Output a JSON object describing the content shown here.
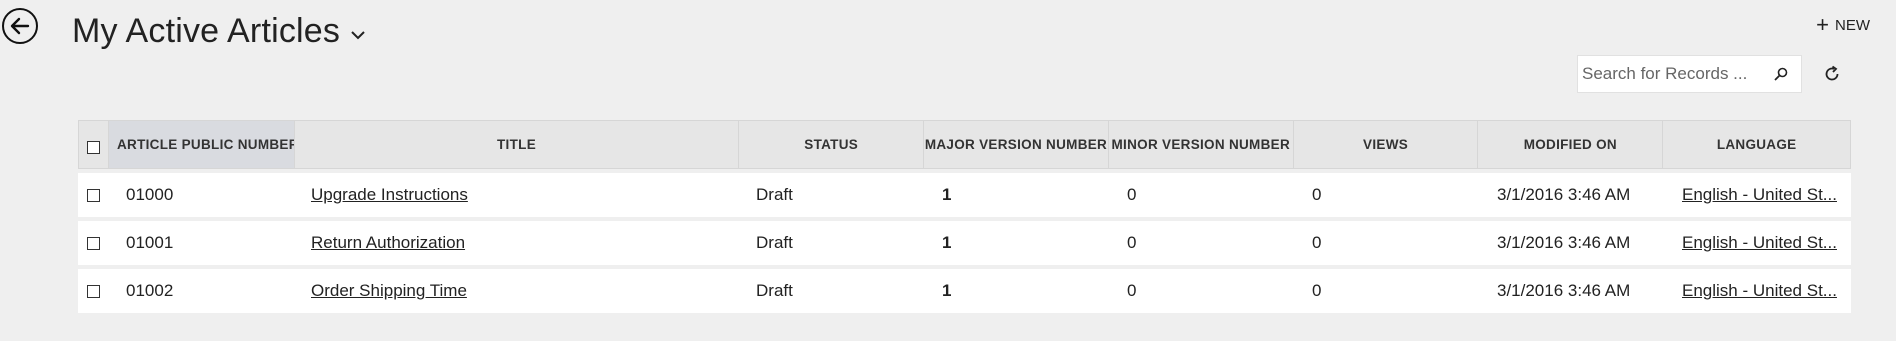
{
  "header": {
    "title": "My Active Articles",
    "new_label": "NEW"
  },
  "search": {
    "placeholder": "Search for Records ..."
  },
  "grid": {
    "columns": [
      "ARTICLE PUBLIC NUMBER",
      "TITLE",
      "STATUS",
      "MAJOR VERSION NUMBER",
      "MINOR VERSION NUMBER",
      "VIEWS",
      "MODIFIED ON",
      "LANGUAGE"
    ],
    "rows": [
      {
        "number": "01000",
        "title": "Upgrade Instructions",
        "status": "Draft",
        "major": "1",
        "minor": "0",
        "views": "0",
        "modified": "3/1/2016 3:46 AM",
        "language": "English - United St..."
      },
      {
        "number": "01001",
        "title": "Return Authorization",
        "status": "Draft",
        "major": "1",
        "minor": "0",
        "views": "0",
        "modified": "3/1/2016 3:46 AM",
        "language": "English - United St..."
      },
      {
        "number": "01002",
        "title": "Order Shipping Time",
        "status": "Draft",
        "major": "1",
        "minor": "0",
        "views": "0",
        "modified": "3/1/2016 3:46 AM",
        "language": "English - United St..."
      }
    ]
  },
  "icons": {
    "back": "back-arrow-icon",
    "chevron": "chevron-down-icon",
    "new": "plus-icon",
    "search": "search-icon",
    "refresh": "refresh-icon"
  }
}
